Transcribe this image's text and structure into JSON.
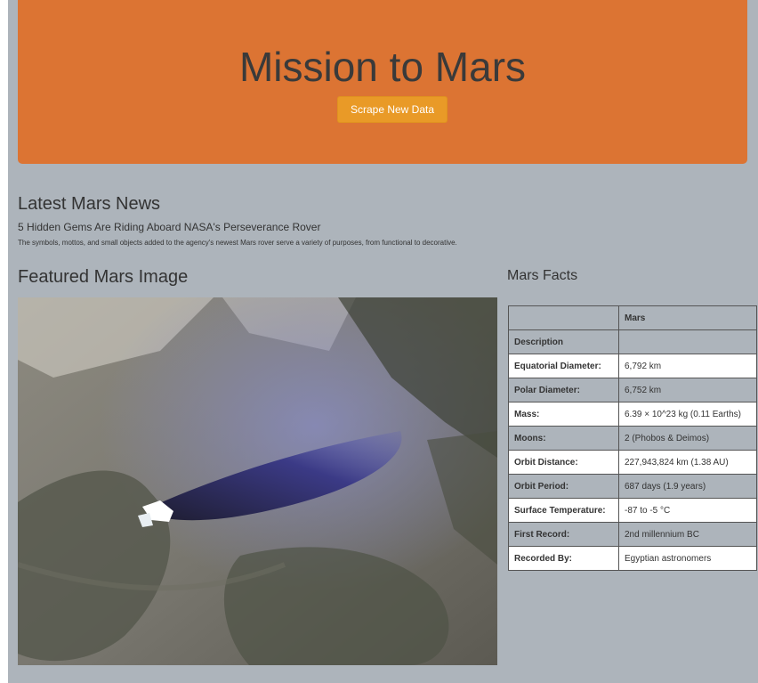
{
  "header": {
    "title": "Mission to Mars",
    "scrape_button_label": "Scrape New Data"
  },
  "news": {
    "heading": "Latest Mars News",
    "title": "5 Hidden Gems Are Riding Aboard NASA's Perseverance Rover",
    "teaser": "The symbols, mottos, and small objects added to the agency's newest Mars rover serve a variety of purposes, from functional to decorative."
  },
  "featured": {
    "heading": "Featured Mars Image"
  },
  "facts": {
    "heading": "Mars Facts",
    "columns": [
      "",
      "Mars"
    ],
    "rows": [
      {
        "label": "Description",
        "value": ""
      },
      {
        "label": "Equatorial Diameter:",
        "value": "6,792 km"
      },
      {
        "label": "Polar Diameter:",
        "value": "6,752 km"
      },
      {
        "label": "Mass:",
        "value": "6.39 × 10^23 kg (0.11 Earths)"
      },
      {
        "label": "Moons:",
        "value": "2 (Phobos & Deimos)"
      },
      {
        "label": "Orbit Distance:",
        "value": "227,943,824 km (1.38 AU)"
      },
      {
        "label": "Orbit Period:",
        "value": "687 days (1.9 years)"
      },
      {
        "label": "Surface Temperature:",
        "value": "-87 to -5 °C"
      },
      {
        "label": "First Record:",
        "value": "2nd millennium BC"
      },
      {
        "label": "Recorded By:",
        "value": "Egyptian astronomers"
      }
    ]
  }
}
